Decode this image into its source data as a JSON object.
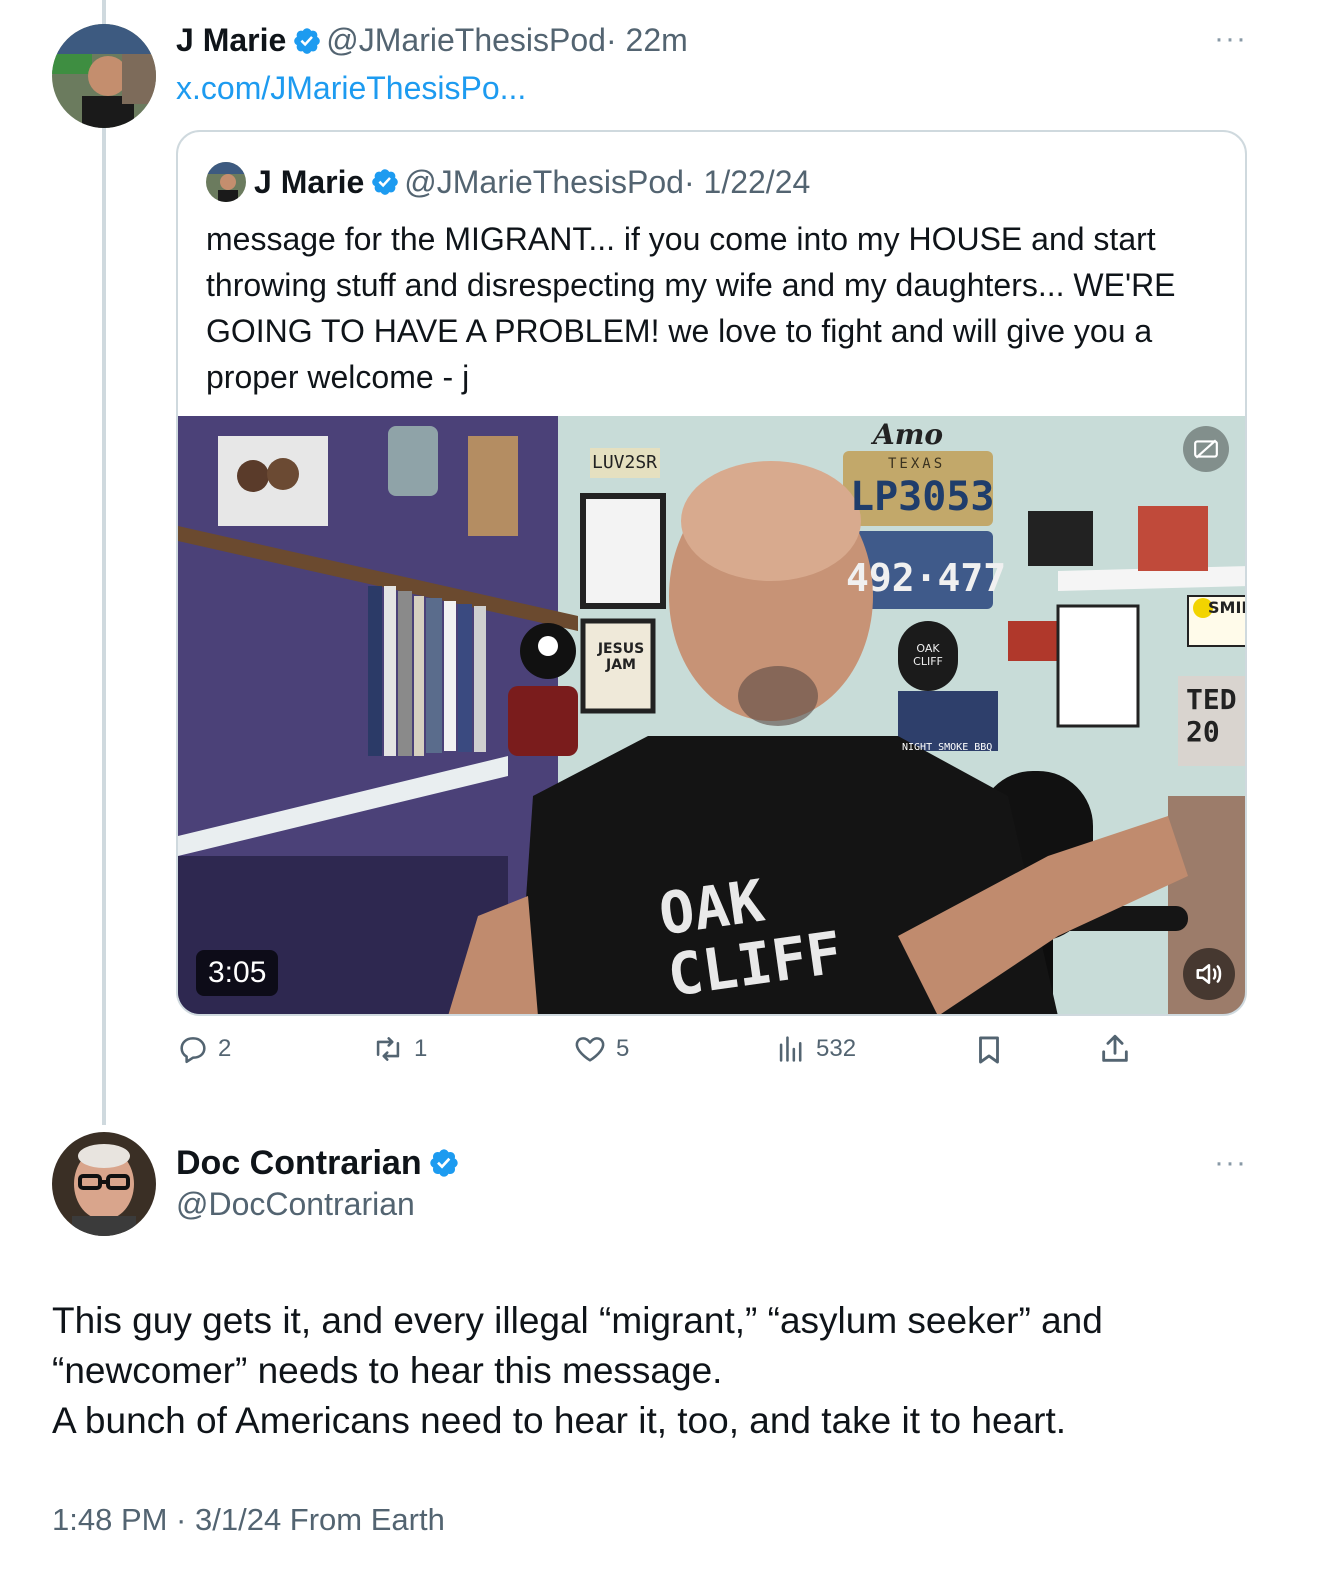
{
  "thread_tweet": {
    "author_name": "J Marie",
    "author_handle": "@JMarieThesisPod",
    "time": "· 22m",
    "link": "x.com/JMarieThesisPo...",
    "more": "···",
    "quoted": {
      "author_name": "J Marie",
      "author_handle": "@JMarieThesisPod",
      "date": "· 1/22/24",
      "text": "message for the MIGRANT... if you come into my HOUSE and start throwing stuff and disrespecting my wife and my daughters... WE'RE GOING TO HAVE A PROBLEM! we love to fight and will give you a proper welcome - j",
      "video": {
        "duration": "3:05",
        "shirt_text": "OAK CLIFF",
        "plate_1": "LP3053",
        "plate_1_state": "TEXAS",
        "plate_2": "492·477",
        "sign_top": "Amo",
        "sign_right_1": "SMIL",
        "sign_right_2": "TED 20",
        "sticker_oak": "OAK CLIFF",
        "sticker_jesus": "JESUS JAM",
        "sticker_luv": "LUV2SR",
        "sticker_smoke": "NIGHT SMOKE BBQ"
      }
    },
    "actions": {
      "replies": "2",
      "reposts": "1",
      "likes": "5",
      "views": "532"
    }
  },
  "main_tweet": {
    "author_name": "Doc Contrarian",
    "author_handle": "@DocContrarian",
    "more": "···",
    "body_lines": [
      "This guy gets it, and every illegal “migrant,” “asylum seeker” and",
      "“newcomer” needs to hear this message.",
      "A bunch of Americans need to hear it, too, and take it to heart."
    ],
    "meta": "1:48 PM · 3/1/24 From Earth"
  },
  "colors": {
    "verified": "#1d9bf0",
    "link": "#1d9bf0",
    "secondary_text": "#536471",
    "border": "#cfd9de"
  }
}
